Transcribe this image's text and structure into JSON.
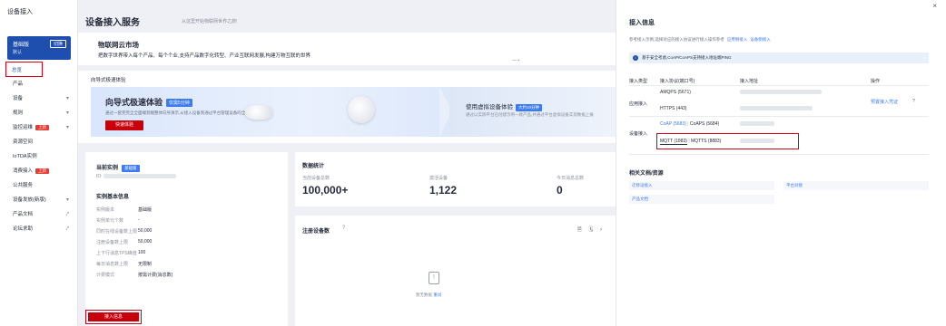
{
  "sidebar": {
    "title": "设备接入",
    "instance": {
      "name": "基础版",
      "sub": "默认",
      "badge": "切换"
    },
    "active_item": "总览",
    "items": [
      {
        "label": "产品",
        "chevron": ""
      },
      {
        "label": "设备",
        "chevron": "▾"
      },
      {
        "label": "规则",
        "chevron": "▾"
      },
      {
        "label": "监控运维",
        "chevron": "▾",
        "tag": "上新"
      },
      {
        "label": "资源空间",
        "chevron": ""
      },
      {
        "label": "IoTDA实例",
        "chevron": ""
      },
      {
        "label": "消费接入",
        "chevron": "",
        "tag": "上新"
      },
      {
        "label": "公共服务",
        "chevron": ""
      },
      {
        "label": "设备发放(新版)",
        "chevron": "▾"
      },
      {
        "label": "产品文档",
        "chevron": "⤤"
      },
      {
        "label": "论坛求助",
        "chevron": "⤤"
      }
    ]
  },
  "header": {
    "title": "设备接入服务",
    "subtitle": "从这里开始物联网世界之旅!"
  },
  "banner": {
    "title": "物联网云市场",
    "desc": "把数字世界带入每个产品、每个个业,支持产品数字化转型、产业互联网发展,构建万物互联的世界",
    "dots": "— ▪"
  },
  "guide": {
    "section_title": "向导式极速体验",
    "card1": {
      "title": "向导式极速体验",
      "tag": "仅需5分钟",
      "desc": "通过一套完完全全面端到端整体向导演示,从接入设备到通过平台管理设备的全景流程",
      "button": "快速体验"
    },
    "card2": {
      "title": "使用虚拟设备体验",
      "tag": "大约10分钟",
      "desc": "通过以实际平台已创建示例一款产品,并通过平台虚拟设备实现数据上报"
    }
  },
  "instance_card": {
    "title": "当前实例",
    "badge": "基础版",
    "id_label": "ID:",
    "section": "实例基本信息",
    "rows": [
      {
        "label": "实例版本",
        "value": "基础版"
      },
      {
        "label": "实例单元个数",
        "value": "-"
      },
      {
        "label": "同时在线设备数上限",
        "value": "50,000"
      },
      {
        "label": "注册设备数上限",
        "value": "50,000"
      },
      {
        "label": "上下行消息TPS峰值",
        "value": "100"
      },
      {
        "label": "每日消息数上限",
        "value": "无限制"
      },
      {
        "label": "计费模式",
        "value": "按需计费(消息数)"
      }
    ],
    "button": "接入信息"
  },
  "stats": {
    "title": "数据统计",
    "cols": [
      {
        "label": "当前设备总数",
        "value": "100,000+"
      },
      {
        "label": "激活设备",
        "value": "1,122"
      },
      {
        "label": "今日消息总数",
        "value": "0"
      }
    ]
  },
  "register": {
    "title": "注册设备数",
    "help": "?",
    "icons": "🗎 🗓 ›",
    "empty_text": "暂无数据",
    "empty_link": "重试",
    "empty_icon": "!"
  },
  "drawer": {
    "title": "接入信息",
    "close": "×",
    "desc": "参考接入示例,选择对应的接入协议进行接入操作参考",
    "desc_links": [
      "应用侧接入",
      "设备侧接入"
    ],
    "info": "基于安全考虑,CoAP/CoAPS支持接入地址端PING",
    "info_icon": "i",
    "headers": [
      "接入类型",
      "接入协议(端口号)",
      "接入地址",
      "操作"
    ],
    "app_type": "应用接入",
    "app_protocols": [
      "AMQPS (5671)",
      "HTTPS (443)"
    ],
    "app_action": "预置接入凭证",
    "app_action_help": "?",
    "dev_type": "设备接入",
    "dev_row1": [
      "CoAP (5683)",
      "CoAPS (5684)"
    ],
    "dev_row2": [
      "MQTT (1883)",
      "MQTTS (8883)"
    ],
    "sep": "|",
    "docs_title": "相关文档/资源",
    "docs": [
      "迁移设接入",
      "平台对接",
      "产品文档"
    ]
  }
}
